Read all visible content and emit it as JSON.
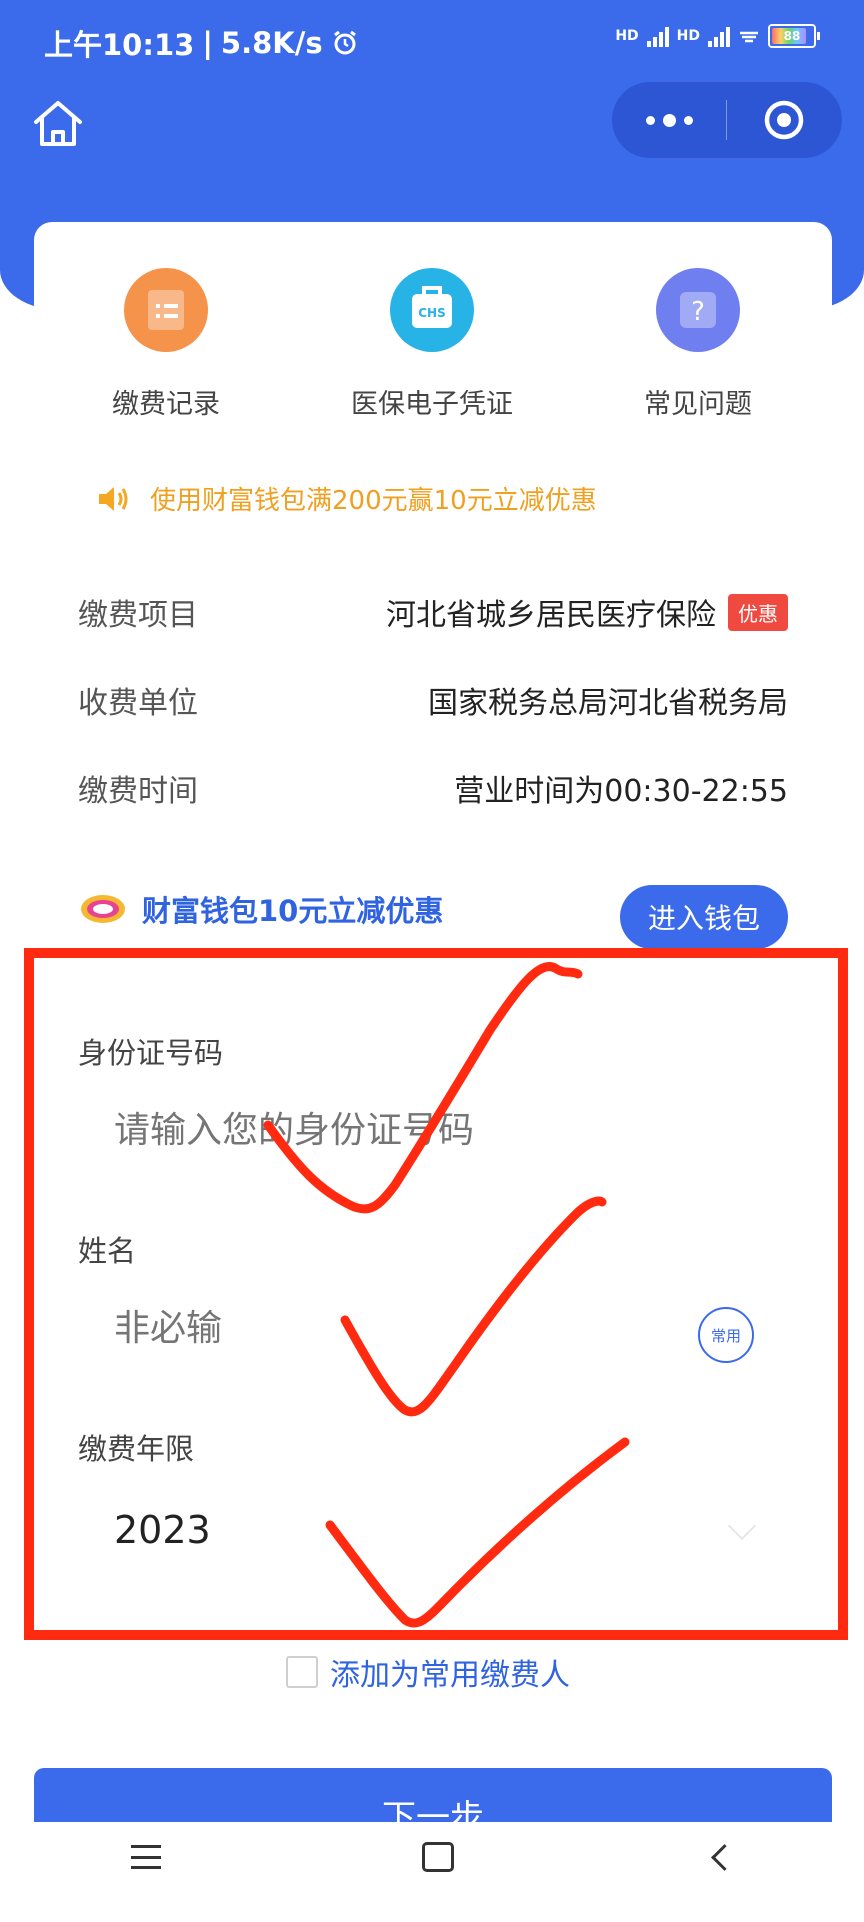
{
  "status_bar": {
    "time": "上午10:13",
    "speed": "5.8K/s",
    "battery": "88"
  },
  "shortcuts": [
    {
      "label": "缴费记录",
      "icon": "payment-record-icon",
      "color": "#f5934a"
    },
    {
      "label": "医保电子凭证",
      "icon": "medical-insurance-voucher-icon",
      "color": "#27b3e6",
      "icon_text": "CHS"
    },
    {
      "label": "常见问题",
      "icon": "faq-icon",
      "color": "#6f7ff0",
      "icon_text": "?"
    }
  ],
  "notice": {
    "text": "使用财富钱包满200元赢10元立减优惠",
    "color": "#f0a020"
  },
  "info": {
    "item": {
      "label": "缴费项目",
      "value": "河北省城乡居民医疗保险",
      "badge": "优惠"
    },
    "unit": {
      "label": "收费单位",
      "value": "国家税务总局河北省税务局"
    },
    "time": {
      "label": "缴费时间",
      "value": "营业时间为00:30-22:55"
    }
  },
  "wallet": {
    "text": "财富钱包10元立减优惠",
    "button": "进入钱包"
  },
  "form": {
    "id": {
      "label": "身份证号码",
      "placeholder": "请输入您的身份证号码"
    },
    "name": {
      "label": "姓名",
      "placeholder": "非必输",
      "common_button": "常用"
    },
    "year": {
      "label": "缴费年限",
      "value": "2023"
    }
  },
  "add_common": {
    "label": "添加为常用缴费人"
  },
  "next_button": {
    "label": "下一步"
  },
  "colors": {
    "primary": "#3b6bea",
    "annotation": "#ff2a10"
  }
}
